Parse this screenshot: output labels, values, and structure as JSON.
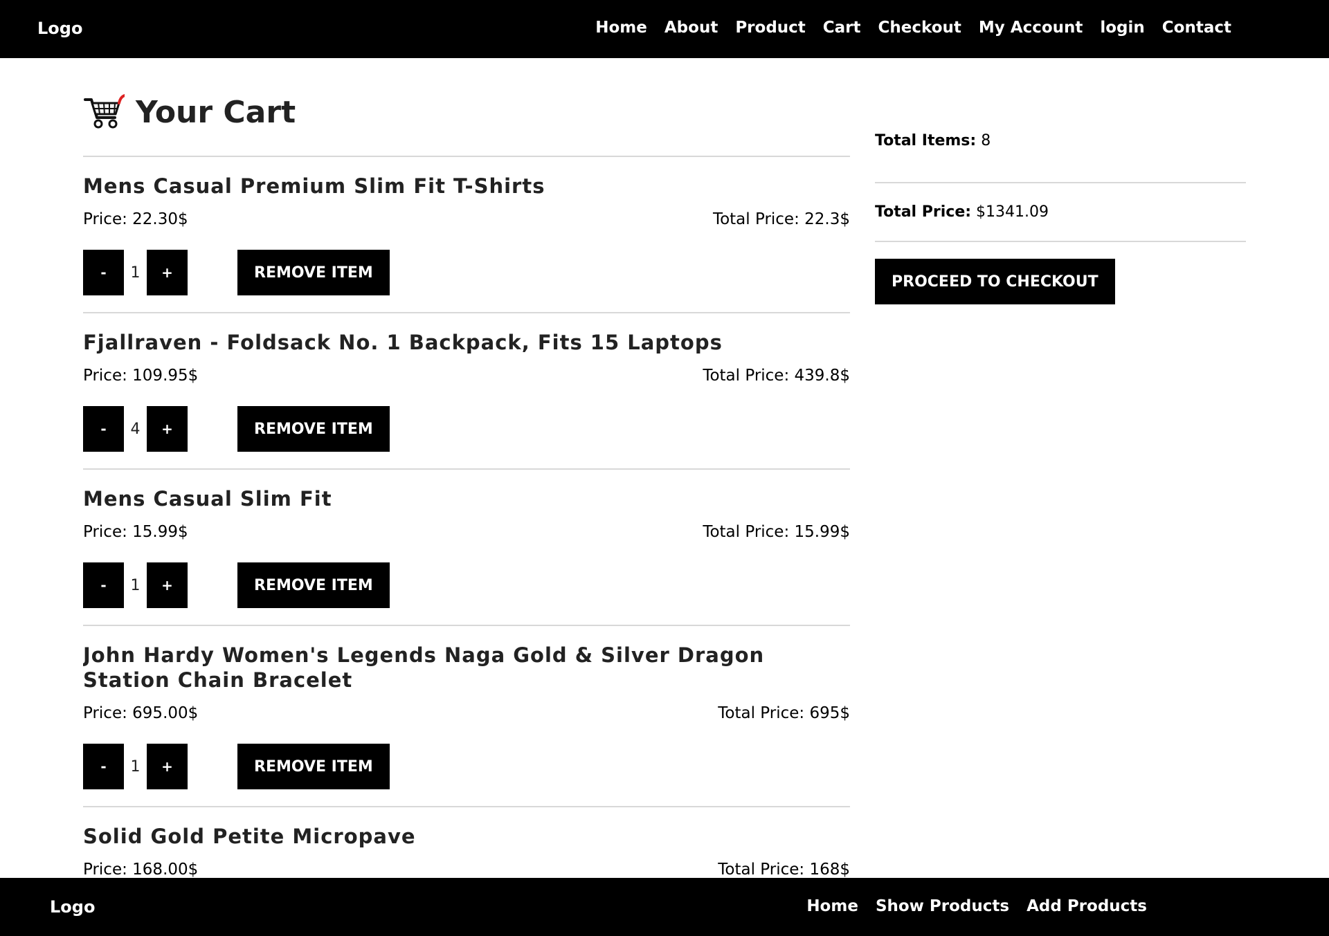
{
  "header": {
    "logo": "Logo",
    "nav": [
      "Home",
      "About",
      "Product",
      "Cart",
      "Checkout",
      "My Account",
      "login",
      "Contact"
    ]
  },
  "cart": {
    "title": "Your Cart",
    "icon": "shopping-cart-icon",
    "items": [
      {
        "name": "Mens Casual Premium Slim Fit T-Shirts",
        "price": "Price: 22.30$",
        "total": "Total Price: 22.3$",
        "qty": "1",
        "minus": "-",
        "plus": "+",
        "remove": "REMOVE ITEM"
      },
      {
        "name": "Fjallraven - Foldsack No. 1 Backpack, Fits 15 Laptops",
        "price": "Price: 109.95$",
        "total": "Total Price: 439.8$",
        "qty": "4",
        "minus": "-",
        "plus": "+",
        "remove": "REMOVE ITEM"
      },
      {
        "name": "Mens Casual Slim Fit",
        "price": "Price: 15.99$",
        "total": "Total Price: 15.99$",
        "qty": "1",
        "minus": "-",
        "plus": "+",
        "remove": "REMOVE ITEM"
      },
      {
        "name": "John Hardy Women's Legends Naga Gold & Silver Dragon Station Chain Bracelet",
        "price": "Price: 695.00$",
        "total": "Total Price: 695$",
        "qty": "1",
        "minus": "-",
        "plus": "+",
        "remove": "REMOVE ITEM"
      },
      {
        "name": "Solid Gold Petite Micropave",
        "price": "Price: 168.00$",
        "total": "Total Price: 168$"
      }
    ]
  },
  "summary": {
    "total_items_label": "Total Items:",
    "total_items_value": "8",
    "total_price_label": "Total Price:",
    "total_price_value": "$1341.09",
    "checkout_label": "PROCEED TO CHECKOUT"
  },
  "footer": {
    "logo": "Logo",
    "nav": [
      "Home",
      "Show Products",
      "Add Products"
    ]
  }
}
